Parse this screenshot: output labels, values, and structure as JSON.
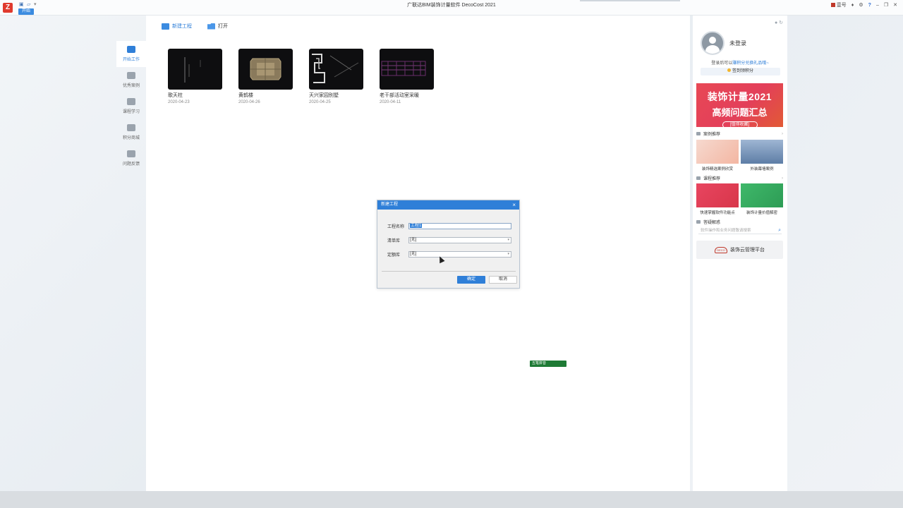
{
  "app": {
    "title": "广联达BIM装饰计量软件 DecoCost 2021",
    "logo": "Z",
    "start_tab": "开始",
    "user_label": "壹号"
  },
  "toolbar": {
    "new_label": "新建工程",
    "open_label": "打开"
  },
  "nav": {
    "items": [
      {
        "label": "开始工作",
        "icon": "monitor-icon"
      },
      {
        "label": "优秀案例",
        "icon": "trophy-icon"
      },
      {
        "label": "课程学习",
        "icon": "book-icon"
      },
      {
        "label": "积分商城",
        "icon": "bag-icon"
      },
      {
        "label": "问题反馈",
        "icon": "feedback-icon"
      }
    ]
  },
  "projects": [
    {
      "name": "歌天柱",
      "date": "2020-04-23"
    },
    {
      "name": "黄鹤楼",
      "date": "2020-04-26"
    },
    {
      "name": "天兴家园别墅",
      "date": "2020-04-25"
    },
    {
      "name": "老干部活动室采暖",
      "date": "2020-04-11"
    }
  ],
  "dialog": {
    "title": "新建工程",
    "close": "×",
    "name_label": "工程名称",
    "name_value": "工程1",
    "list_label": "清单库",
    "list_value": "[无]",
    "quota_label": "定额库",
    "quota_value": "[无]",
    "ok_label": "确定",
    "cancel_label": "取消"
  },
  "ime": {
    "label": "五笔拼音"
  },
  "right_panel": {
    "user_name": "未登录",
    "login_tip_prefix": "登录后可以",
    "login_tip_link": "赚积分兑换礼品哦~",
    "signin_label": "签到领积分",
    "banner": {
      "line1": "装饰计量2021",
      "line2": "高频问题汇总",
      "line3": "[值得收藏]"
    },
    "case_section": "案例推荐",
    "cases": [
      "装饰精选案例欣赏",
      "外装幕墙案例"
    ],
    "course_section": "课程推荐",
    "courses": [
      "快速掌握软件功能点",
      "装饰计量价值解密"
    ],
    "qa_section": "答疑解惑",
    "qa_placeholder": "软件操作和业务问题敬请搜索",
    "cloud_logo": "DECO",
    "cloud_label": "装饰云管理平台"
  },
  "colors": {
    "accent": "#2f7fd8",
    "banner": "#e84855",
    "dialog_title": "#2f7fd8"
  }
}
